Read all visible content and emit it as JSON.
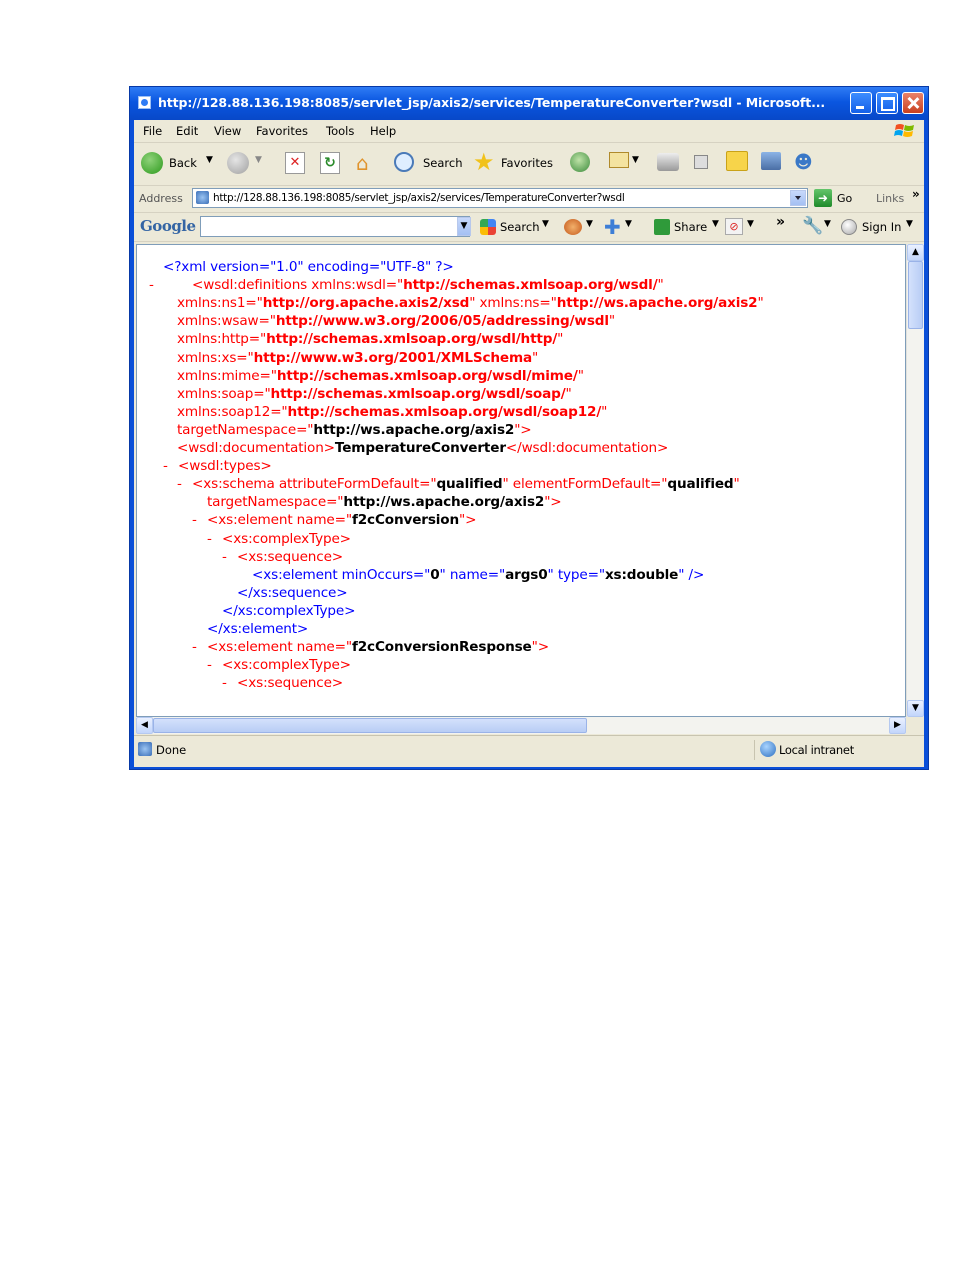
{
  "window": {
    "title": "http://128.88.136.198:8085/servlet_jsp/axis2/services/TemperatureConverter?wsdl - Microsoft..."
  },
  "menu": [
    "File",
    "Edit",
    "View",
    "Favorites",
    "Tools",
    "Help"
  ],
  "toolbar": {
    "back_label": "Back",
    "search_label": "Search",
    "favorites_label": "Favorites"
  },
  "address": {
    "label": "Address",
    "url": "http://128.88.136.198:8085/servlet_jsp/axis2/services/TemperatureConverter?wsdl",
    "go_label": "Go",
    "links_label": "Links",
    "chevron": "»"
  },
  "google": {
    "logo": "Google",
    "search_value": "",
    "search_label": "Search",
    "share_label": "Share",
    "chevron": "»",
    "signin_label": "Sign In"
  },
  "xml_lines": [
    {
      "dash": "",
      "parts": [
        {
          "t": "<?xml version=\"1.0\" encoding=\"UTF-8\" ?>",
          "c": "blue"
        }
      ]
    },
    {
      "dash": "-",
      "parts": [
        {
          "t": "<wsdl:definitions ",
          "c": "red"
        },
        {
          "t": "xmlns:wsdl=\"",
          "c": "red"
        },
        {
          "t": "http://schemas.xmlsoap.org/wsdl/",
          "c": "red",
          "b": true
        },
        {
          "t": "\"",
          "c": "red"
        }
      ]
    },
    {
      "dash": "",
      "parts": [
        {
          "t": "xmlns:ns1=\"",
          "c": "red"
        },
        {
          "t": "http://org.apache.axis2/xsd",
          "c": "red",
          "b": true
        },
        {
          "t": "\" xmlns:ns=\"",
          "c": "red"
        },
        {
          "t": "http://ws.apache.org/axis2",
          "c": "red",
          "b": true
        },
        {
          "t": "\"",
          "c": "red"
        }
      ]
    },
    {
      "dash": "",
      "parts": [
        {
          "t": "xmlns:wsaw=\"",
          "c": "red"
        },
        {
          "t": "http://www.w3.org/2006/05/addressing/wsdl",
          "c": "red",
          "b": true
        },
        {
          "t": "\"",
          "c": "red"
        }
      ]
    },
    {
      "dash": "",
      "parts": [
        {
          "t": "xmlns:http=\"",
          "c": "red"
        },
        {
          "t": "http://schemas.xmlsoap.org/wsdl/http/",
          "c": "red",
          "b": true
        },
        {
          "t": "\"",
          "c": "red"
        }
      ]
    },
    {
      "dash": "",
      "parts": [
        {
          "t": "xmlns:xs=\"",
          "c": "red"
        },
        {
          "t": "http://www.w3.org/2001/XMLSchema",
          "c": "red",
          "b": true
        },
        {
          "t": "\"",
          "c": "red"
        }
      ]
    },
    {
      "dash": "",
      "parts": [
        {
          "t": "xmlns:mime=\"",
          "c": "red"
        },
        {
          "t": "http://schemas.xmlsoap.org/wsdl/mime/",
          "c": "red",
          "b": true
        },
        {
          "t": "\"",
          "c": "red"
        }
      ]
    },
    {
      "dash": "",
      "parts": [
        {
          "t": "xmlns:soap=\"",
          "c": "red"
        },
        {
          "t": "http://schemas.xmlsoap.org/wsdl/soap/",
          "c": "red",
          "b": true
        },
        {
          "t": "\"",
          "c": "red"
        }
      ]
    },
    {
      "dash": "",
      "parts": [
        {
          "t": "xmlns:soap12=\"",
          "c": "red"
        },
        {
          "t": "http://schemas.xmlsoap.org/wsdl/soap12/",
          "c": "red",
          "b": true
        },
        {
          "t": "\"",
          "c": "red"
        }
      ]
    },
    {
      "dash": "",
      "parts": [
        {
          "t": "targetNamespace=\"",
          "c": "red"
        },
        {
          "t": "http://ws.apache.org/axis2",
          "c": "blk",
          "b": true
        },
        {
          "t": "\">",
          "c": "red"
        }
      ]
    },
    {
      "dash": "",
      "parts": [
        {
          "t": "<wsdl:documentation>",
          "c": "red"
        },
        {
          "t": "TemperatureConverter",
          "c": "blk",
          "b": true
        },
        {
          "t": "</wsdl:documentation>",
          "c": "red"
        }
      ]
    },
    {
      "dash": "-",
      "parts": [
        {
          "t": "<wsdl:types>",
          "c": "red"
        }
      ]
    },
    {
      "dash": "-",
      "parts": [
        {
          "t": "<xs:schema attributeFormDefault=\"",
          "c": "red"
        },
        {
          "t": "qualified",
          "c": "blk",
          "b": true
        },
        {
          "t": "\" elementFormDefault=\"",
          "c": "red"
        },
        {
          "t": "qualified",
          "c": "blk",
          "b": true
        },
        {
          "t": "\"",
          "c": "red"
        }
      ]
    },
    {
      "dash": "",
      "parts": [
        {
          "t": "targetNamespace=\"",
          "c": "red"
        },
        {
          "t": "http://ws.apache.org/axis2",
          "c": "blk",
          "b": true
        },
        {
          "t": "\">",
          "c": "red"
        }
      ]
    },
    {
      "dash": "-",
      "parts": [
        {
          "t": "<xs:element name=\"",
          "c": "red"
        },
        {
          "t": "f2cConversion",
          "c": "blk",
          "b": true
        },
        {
          "t": "\">",
          "c": "red"
        }
      ]
    },
    {
      "dash": "-",
      "parts": [
        {
          "t": "<xs:complexType>",
          "c": "red"
        }
      ]
    },
    {
      "dash": "-",
      "parts": [
        {
          "t": "<xs:sequence>",
          "c": "red"
        }
      ]
    },
    {
      "dash": "",
      "parts": [
        {
          "t": "<xs:element minOccurs=\"",
          "c": "blue"
        },
        {
          "t": "0",
          "c": "blk",
          "b": true
        },
        {
          "t": "\" name=\"",
          "c": "blue"
        },
        {
          "t": "args0",
          "c": "blk",
          "b": true
        },
        {
          "t": "\" type=\"",
          "c": "blue"
        },
        {
          "t": "xs:double",
          "c": "blk",
          "b": true
        },
        {
          "t": "\" />",
          "c": "blue"
        }
      ]
    },
    {
      "dash": "",
      "parts": [
        {
          "t": "</xs:sequence>",
          "c": "blue"
        }
      ]
    },
    {
      "dash": "",
      "parts": [
        {
          "t": "</xs:complexType>",
          "c": "blue"
        }
      ]
    },
    {
      "dash": "",
      "parts": [
        {
          "t": "</xs:element>",
          "c": "blue"
        }
      ]
    },
    {
      "dash": "-",
      "parts": [
        {
          "t": "<xs:element name=\"",
          "c": "red"
        },
        {
          "t": "f2cConversionResponse",
          "c": "blk",
          "b": true
        },
        {
          "t": "\">",
          "c": "red"
        }
      ]
    },
    {
      "dash": "-",
      "parts": [
        {
          "t": "<xs:complexType>",
          "c": "red"
        }
      ]
    },
    {
      "dash": "-",
      "parts": [
        {
          "t": "<xs:sequence>",
          "c": "red"
        }
      ]
    }
  ],
  "status": {
    "left": "Done",
    "zone": "Local intranet"
  },
  "colors": {
    "titlebar": "#0a56e0",
    "chrome": "#ece9d8",
    "xml_blue": "#0000ff",
    "xml_red": "#ff0000"
  }
}
